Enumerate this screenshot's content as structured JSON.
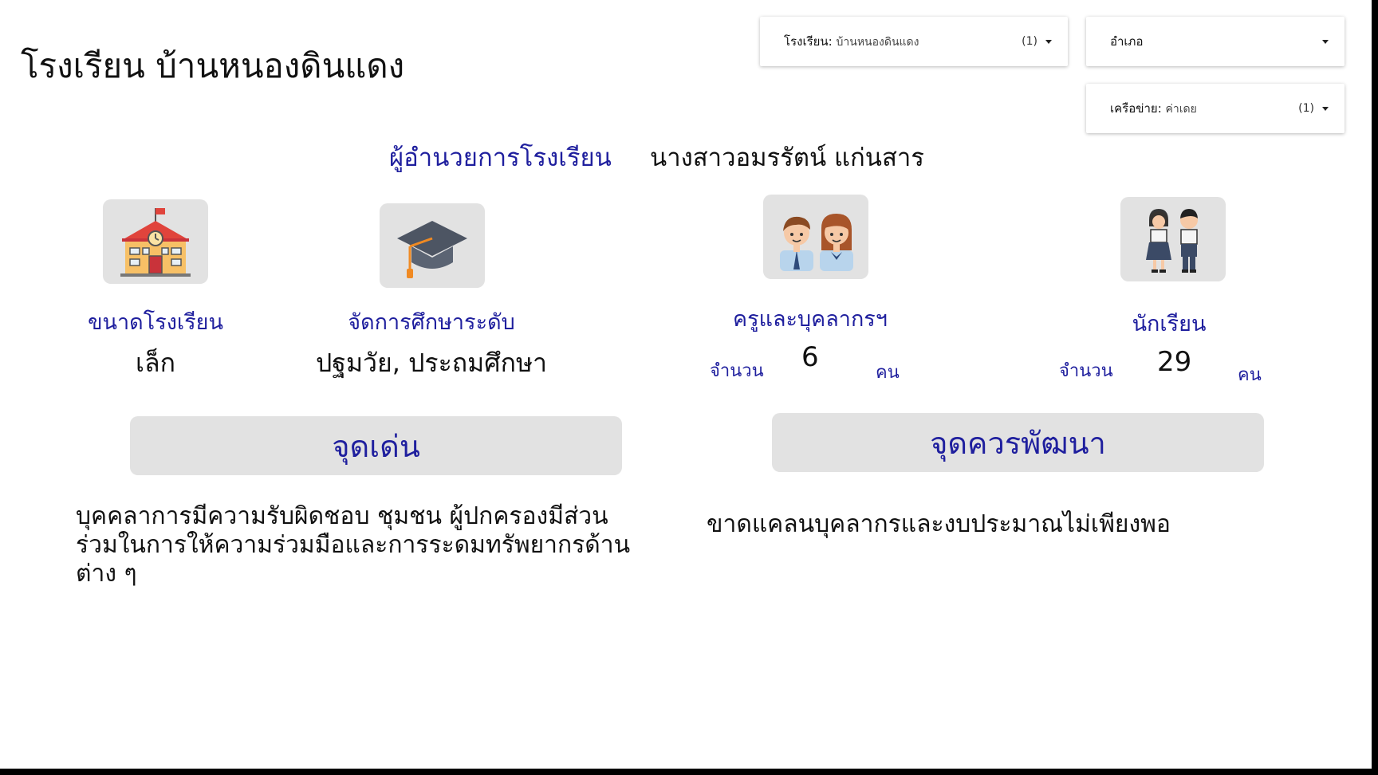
{
  "school_title": "โรงเรียน บ้านหนองดินแดง",
  "filters": {
    "school": {
      "label": "โรงเรียน",
      "value": "บ้านหนองดินแดง",
      "count": "(1)"
    },
    "district": {
      "label": "อำเภอ"
    },
    "network": {
      "label": "เครือข่าย",
      "value": "ค่าเดย",
      "count": "(1)"
    }
  },
  "director": {
    "label": "ผู้อำนวยการโรงเรียน",
    "name": "นางสาวอมรรัตน์ แก่นสาร"
  },
  "cards": {
    "size": {
      "label": "ขนาดโรงเรียน",
      "value": "เล็ก",
      "icon": "school-building-icon"
    },
    "level": {
      "label": "จัดการศึกษาระดับ",
      "value": "ปฐมวัย, ประถมศึกษา",
      "icon": "graduation-cap-icon"
    },
    "teachers": {
      "label": "ครูและบุคลากรฯ",
      "count_label": "จำนวน",
      "count": "6",
      "unit": "คน",
      "icon": "teachers-icon"
    },
    "students": {
      "label": "นักเรียน",
      "count_label": "จำนวน",
      "count": "29",
      "unit": "คน",
      "icon": "students-icon"
    }
  },
  "strengths": {
    "heading": "จุดเด่น",
    "lines": [
      "บุคคลาการมีความรับผิดชอบ ชุมชน ผู้ปกครองมีส่วน",
      "ร่วมในการให้ความร่วมมือและการระดมทรัพยากรด้าน",
      "ต่าง ๆ"
    ]
  },
  "improvements": {
    "heading": "จุดควรพัฒนา",
    "text": "ขาดแคลนบุคลากรและงบประมาณไม่เพียงพอ"
  },
  "colors": {
    "accent": "#1f1f9e",
    "card_bg": "#e2e2e2"
  }
}
